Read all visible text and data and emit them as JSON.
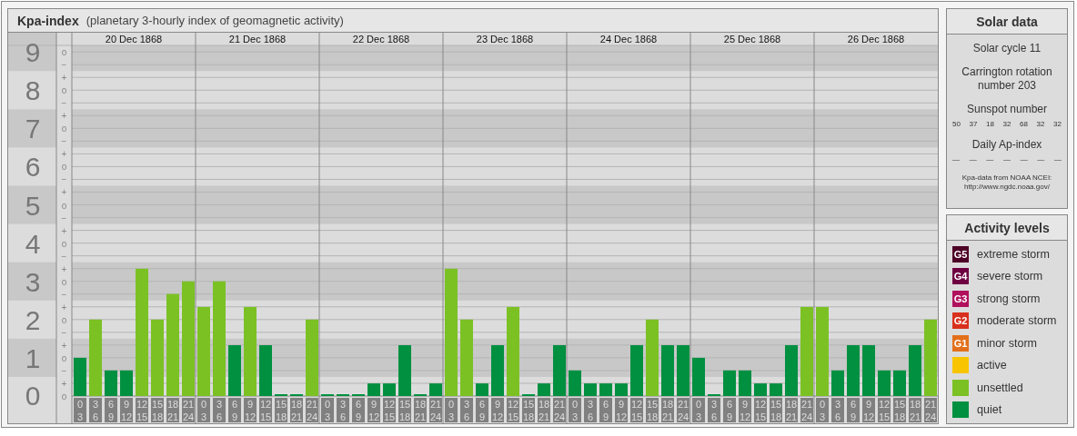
{
  "kpa_panel": {
    "title": "Kpa-index",
    "subtitle": "(planetary 3-hourly index of geomagnetic activity)",
    "minor_ticks": [
      "o",
      "−",
      "+",
      "o",
      "−",
      "+",
      "o",
      "−",
      "+",
      "o",
      "−",
      "+",
      "o",
      "−",
      "+",
      "o",
      "−",
      "+",
      "o",
      "−",
      "+",
      "o",
      "−",
      "+",
      "o",
      "−",
      "+",
      "o"
    ],
    "dates": [
      "20 Dec 1868",
      "21 Dec 1868",
      "22 Dec 1868",
      "23 Dec 1868",
      "24 Dec 1868",
      "25 Dec 1868",
      "26 Dec 1868"
    ],
    "chart_data": {
      "type": "bar",
      "stacked": false,
      "categories": [
        "0 3",
        "3 6",
        "6 9",
        "9 12",
        "12 15",
        "15 18",
        "18 21",
        "21 24",
        "0 3",
        "3 6",
        "6 9",
        "9 12",
        "12 15",
        "15 18",
        "18 21",
        "21 24",
        "0 3",
        "3 6",
        "6 9",
        "9 12",
        "12 15",
        "15 18",
        "18 21",
        "21 24",
        "0 3",
        "3 6",
        "6 9",
        "9 12",
        "12 15",
        "15 18",
        "18 21",
        "21 24",
        "0 3",
        "3 6",
        "6 9",
        "9 12",
        "12 15",
        "15 18",
        "18 21",
        "21 24",
        "0 3",
        "3 6",
        "6 9",
        "9 12",
        "12 15",
        "15 18",
        "18 21",
        "21 24",
        "0 3",
        "3 6",
        "6 9",
        "9 12",
        "12 15",
        "15 18",
        "18 21",
        "21 24"
      ],
      "series": [
        {
          "color": "#009040",
          "values": [
            1,
            null,
            0.67,
            0.67,
            null,
            null,
            null,
            null,
            null,
            null,
            1.33,
            null,
            1.33,
            0,
            0,
            null,
            0,
            0,
            0,
            0.33,
            0.33,
            1.33,
            0,
            0.33,
            null,
            null,
            0.33,
            1.33,
            null,
            0,
            0.33,
            1.33,
            0.67,
            0.33,
            0.33,
            0.33,
            1.33,
            null,
            1.33,
            1.33,
            1,
            0,
            0.67,
            0.67,
            0.33,
            0.33,
            1.33,
            null,
            null,
            0.67,
            1.33,
            1.33,
            0.67,
            0.67,
            1.33,
            null
          ]
        },
        {
          "color": "#7bc124",
          "values": [
            null,
            2,
            null,
            null,
            3.33,
            2,
            2.67,
            3,
            2.33,
            3,
            null,
            2.33,
            null,
            null,
            null,
            2,
            null,
            null,
            null,
            null,
            null,
            null,
            null,
            null,
            3.33,
            2,
            null,
            null,
            2.33,
            null,
            null,
            null,
            null,
            null,
            null,
            null,
            null,
            2,
            null,
            null,
            null,
            null,
            null,
            null,
            null,
            null,
            null,
            2.33,
            2.33,
            null,
            null,
            null,
            null,
            null,
            null,
            2
          ]
        }
      ],
      "ylim": [
        0,
        9.17
      ],
      "yticks": [
        0,
        1,
        2,
        3,
        4,
        5,
        6,
        7,
        8,
        9
      ],
      "grid": true
    },
    "shaded_levels": [
      "9",
      "7",
      "5",
      "3",
      "1"
    ]
  },
  "solar_data": {
    "title": "Solar data",
    "solar_cycle": "Solar cycle 11",
    "carrington": "Carrington rotation number 203",
    "sunspot_title": "Sunspot number",
    "sunspots": [
      "50",
      "37",
      "18",
      "32",
      "68",
      "32",
      "32"
    ],
    "ap_title": "Daily Ap-index",
    "ap_values": [
      "—",
      "—",
      "—",
      "—",
      "—",
      "—",
      "—"
    ],
    "source": "Kpa-data from NOAA NCEI:",
    "source_url": "http://www.ngdc.noaa.gov/"
  },
  "activity_levels": {
    "title": "Activity levels",
    "items": [
      {
        "code": "G5",
        "label": "extreme storm",
        "color": "#4d0026"
      },
      {
        "code": "G4",
        "label": "severe storm",
        "color": "#6e0042"
      },
      {
        "code": "G3",
        "label": "strong storm",
        "color": "#b0105c"
      },
      {
        "code": "G2",
        "label": "moderate storm",
        "color": "#d8301c"
      },
      {
        "code": "G1",
        "label": "minor storm",
        "color": "#e2701a"
      },
      {
        "label": "active",
        "color": "#f8c400"
      },
      {
        "label": "unsettled",
        "color": "#7bc124"
      },
      {
        "label": "quiet",
        "color": "#009040"
      }
    ]
  }
}
